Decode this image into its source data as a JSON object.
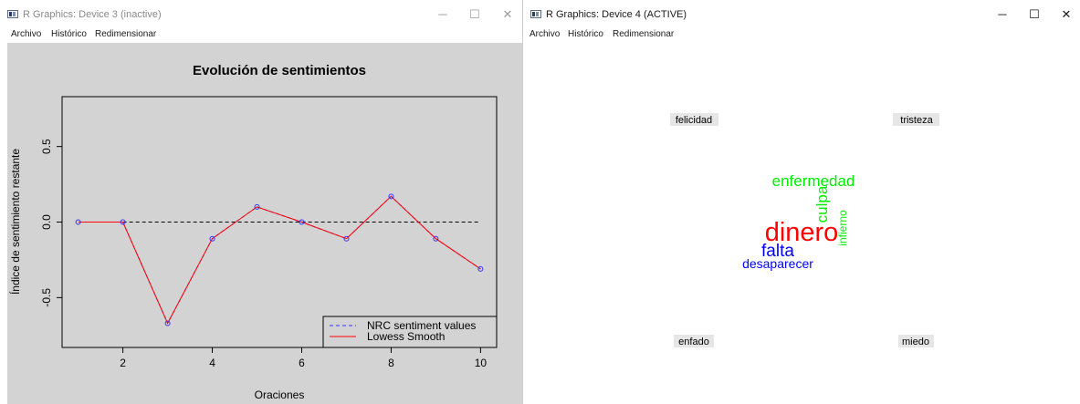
{
  "device3": {
    "title": "R Graphics: Device 3 (inactive)",
    "controls": {
      "minimize": "─",
      "maximize": "☐",
      "close": "✕"
    },
    "menu": [
      "Archivo",
      "Histórico",
      "Redimensionar"
    ]
  },
  "device4": {
    "title": "R Graphics: Device 4 (ACTIVE)",
    "controls": {
      "minimize": "─",
      "maximize": "☐",
      "close": "✕"
    },
    "menu": [
      "Archivo",
      "Histórico",
      "Redimensionar"
    ]
  },
  "chart_data": [
    {
      "type": "line",
      "title": "Evolución de sentimientos",
      "xlabel": "Oraciones",
      "ylabel": "Índice de sentimiento restante",
      "xlim": [
        0.64,
        10.36
      ],
      "ylim": [
        -0.83,
        0.83
      ],
      "xticks": [
        2,
        4,
        6,
        8,
        10
      ],
      "yticks": [
        -0.5,
        0.0,
        0.5
      ],
      "reference_line": 0,
      "grid": false,
      "legend_position": "bottom-right",
      "series": [
        {
          "name": "NRC sentiment values",
          "style": "dashed",
          "color": "#3333ff",
          "x": [
            1,
            2,
            3,
            4,
            5,
            6,
            7,
            8,
            9,
            10
          ],
          "y": [
            0,
            0,
            -0.67,
            -0.11,
            0.1,
            0,
            -0.11,
            0.17,
            -0.11,
            -0.31
          ]
        },
        {
          "name": "Lowess Smooth",
          "style": "solid",
          "color": "#ff0000",
          "x": [
            1,
            2,
            3,
            4,
            5,
            6,
            7,
            8,
            9,
            10
          ],
          "y": [
            0,
            0,
            -0.67,
            -0.11,
            0.1,
            0,
            -0.11,
            0.17,
            -0.11,
            -0.31
          ]
        }
      ]
    },
    {
      "type": "comparison-wordcloud",
      "corner_labels": [
        "felicidad",
        "tristeza",
        "enfado",
        "miedo"
      ],
      "words": [
        {
          "text": "enfermedad",
          "color": "#00ee00",
          "weight": 3
        },
        {
          "text": "culpa",
          "color": "#00ee00",
          "weight": 3,
          "rotated": true
        },
        {
          "text": "infierno",
          "color": "#00ee00",
          "weight": 2,
          "rotated": true
        },
        {
          "text": "dinero",
          "color": "#ff0000",
          "weight": 6
        },
        {
          "text": "falta",
          "color": "#0000ff",
          "weight": 4
        },
        {
          "text": "desaparecer",
          "color": "#0000ff",
          "weight": 3
        }
      ]
    }
  ]
}
